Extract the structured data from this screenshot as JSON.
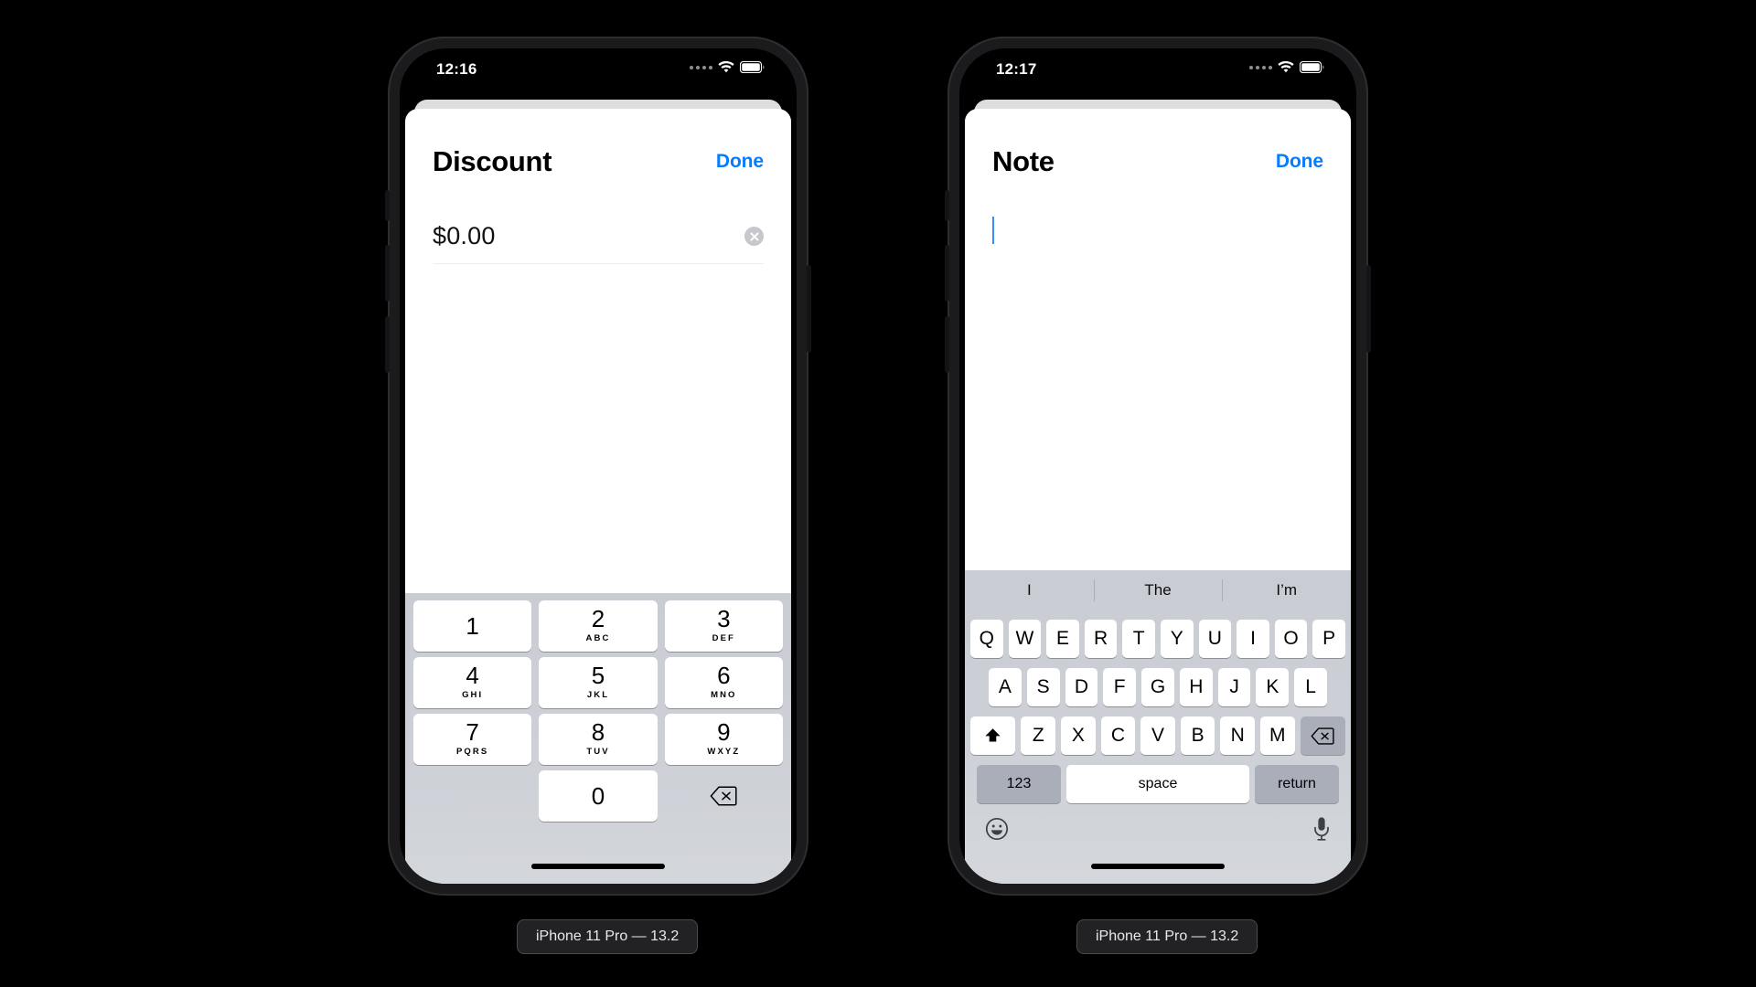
{
  "devices": [
    {
      "id": "left",
      "caption": "iPhone 11 Pro — 13.2",
      "status": {
        "time": "12:16",
        "wifi_icon": "wifi-icon",
        "battery_icon": "battery-icon",
        "signal_icon": "signal-dots-icon"
      },
      "sheet": {
        "title": "Discount",
        "done_label": "Done",
        "amount_value": "$0.00",
        "clear_icon": "clear-circle-icon"
      },
      "keypad": {
        "keys": [
          {
            "num": "1",
            "sub": ""
          },
          {
            "num": "2",
            "sub": "ABC"
          },
          {
            "num": "3",
            "sub": "DEF"
          },
          {
            "num": "4",
            "sub": "GHI"
          },
          {
            "num": "5",
            "sub": "JKL"
          },
          {
            "num": "6",
            "sub": "MNO"
          },
          {
            "num": "7",
            "sub": "PQRS"
          },
          {
            "num": "8",
            "sub": "TUV"
          },
          {
            "num": "9",
            "sub": "WXYZ"
          },
          {
            "num": "0",
            "sub": ""
          }
        ],
        "delete_icon": "backspace-icon"
      }
    },
    {
      "id": "right",
      "caption": "iPhone 11 Pro — 13.2",
      "status": {
        "time": "12:17",
        "wifi_icon": "wifi-icon",
        "battery_icon": "battery-icon",
        "signal_icon": "signal-dots-icon"
      },
      "sheet": {
        "title": "Note",
        "done_label": "Done",
        "note_value": "",
        "caret_icon": "text-caret"
      },
      "keyboard": {
        "predictions": [
          "I",
          "The",
          "I’m"
        ],
        "row1": [
          "Q",
          "W",
          "E",
          "R",
          "T",
          "Y",
          "U",
          "I",
          "O",
          "P"
        ],
        "row2": [
          "A",
          "S",
          "D",
          "F",
          "G",
          "H",
          "J",
          "K",
          "L"
        ],
        "row3": [
          "Z",
          "X",
          "C",
          "V",
          "B",
          "N",
          "M"
        ],
        "shift_icon": "shift-arrow-icon",
        "backspace_icon": "backspace-icon",
        "numbers_label": "123",
        "space_label": "space",
        "return_label": "return",
        "emoji_icon": "emoji-smiley-icon",
        "dictation_icon": "microphone-icon"
      }
    }
  ],
  "colors": {
    "accent_blue": "#067cff",
    "caret_blue": "#3a8bfd",
    "keyboard_bg": "#cdd0d6",
    "key_white": "#ffffff",
    "key_gray": "#a9aeb8",
    "page_bg": "#000000"
  }
}
